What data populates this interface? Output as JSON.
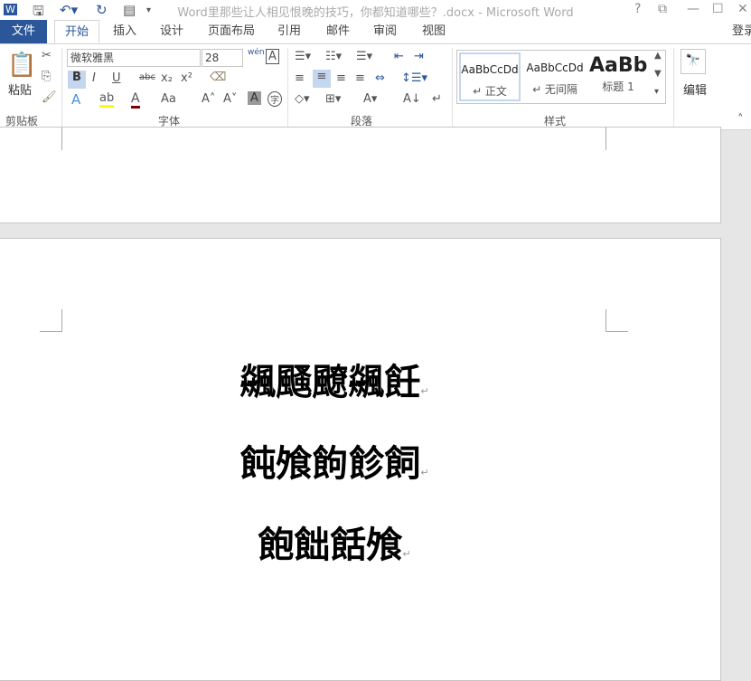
{
  "titlebar": {
    "title": "Word里那些让人相见恨晚的技巧，你都知道哪些？.docx - Microsoft Word",
    "help": "?",
    "restore": "⧉",
    "minimize": "—",
    "maximize": "☐",
    "close": "✕"
  },
  "tabs": {
    "file": "文件",
    "items": [
      "开始",
      "插入",
      "设计",
      "页面布局",
      "引用",
      "邮件",
      "审阅",
      "视图"
    ],
    "signin": "登录"
  },
  "clipboard": {
    "paste": "粘贴",
    "label": "剪贴板"
  },
  "font": {
    "name": "微软雅黑",
    "size": "28",
    "label": "字体",
    "bold": "B",
    "italic": "I",
    "underline": "U",
    "strike": "abc",
    "sub": "x₂",
    "sup": "x²",
    "case": "Aa",
    "wen": "wén"
  },
  "paragraph": {
    "label": "段落"
  },
  "styles": {
    "label": "样式",
    "items": [
      {
        "sample": "AaBbCcDd",
        "name": "↵ 正文"
      },
      {
        "sample": "AaBbCcDd",
        "name": "↵ 无间隔"
      },
      {
        "sample": "AaBb",
        "name": "标题 1"
      }
    ]
  },
  "editing": {
    "label": "编辑"
  },
  "document": {
    "lines": [
      "飊颾飉飊飪",
      "飩飧䬲飻飼",
      "飽飿餂飧"
    ],
    "para_mark": "↵"
  }
}
